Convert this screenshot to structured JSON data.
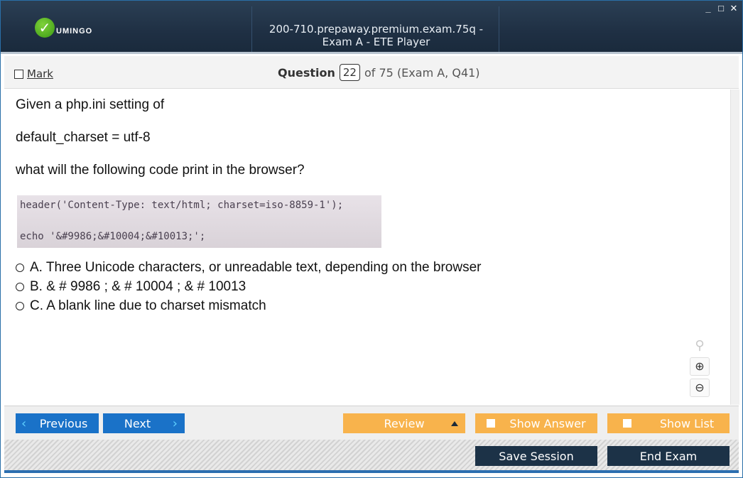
{
  "window": {
    "title": "200-710.prepaway.premium.exam.75q - Exam A - ETE Player",
    "logo_text": "UMINGO",
    "controls": [
      "_",
      "□",
      "✕"
    ]
  },
  "question_bar": {
    "mark_label": "Mark",
    "question_label": "Question",
    "question_number": "22",
    "question_of": "of 75 (Exam A, Q41)"
  },
  "question": {
    "line1": "Given a php.ini setting of",
    "line2": "default_charset = utf-8",
    "line3": "what will the following code print in the browser?",
    "code_line1": "header('Content-Type: text/html; charset=iso-8859-1');",
    "code_line2": "echo '&#9986;&#10004;&#10013;';",
    "answers": [
      {
        "text": "A. Three Unicode characters, or unreadable text, depending on the browser"
      },
      {
        "text": "B. & # 9986 ; & # 10004 ; & # 10013"
      },
      {
        "text": "C. A blank line due to charset mismatch"
      }
    ]
  },
  "tools": {
    "find_icon": "magnifier-icon",
    "zoom_in_icon": "zoom-in-icon",
    "zoom_out_icon": "zoom-out-icon"
  },
  "nav": {
    "previous": "Previous",
    "next": "Next",
    "review": "Review",
    "show_answer": "Show Answer",
    "show_list": "Show List",
    "save_session": "Save Session",
    "end_exam": "End Exam"
  },
  "colors": {
    "nav_blue": "#1a72c8",
    "orange": "#f8b34c",
    "dark": "#1c3247",
    "title_bg": "#1f3044"
  }
}
